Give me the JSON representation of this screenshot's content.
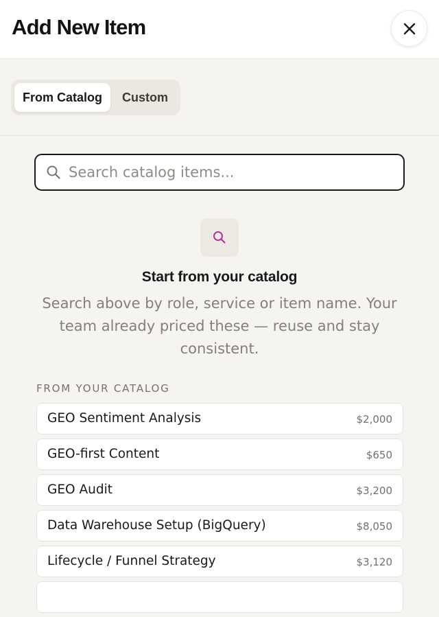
{
  "dialog": {
    "title": "Add New Item"
  },
  "tabs": [
    {
      "label": "From Catalog",
      "active": true
    },
    {
      "label": "Custom",
      "active": false
    }
  ],
  "search": {
    "placeholder": "Search catalog items...",
    "value": ""
  },
  "empty_state": {
    "icon": "search-icon",
    "title": "Start from your catalog",
    "description": "Search above by role, service or item name. Your team already priced these — reuse and stay consistent."
  },
  "catalog": {
    "section_label": "FROM YOUR CATALOG",
    "items": [
      {
        "name": "GEO Sentiment Analysis",
        "price": "$2,000"
      },
      {
        "name": "GEO-first Content",
        "price": "$650"
      },
      {
        "name": "GEO Audit",
        "price": "$3,200"
      },
      {
        "name": "Data Warehouse Setup (BigQuery)",
        "price": "$8,050"
      },
      {
        "name": "Lifecycle / Funnel Strategy",
        "price": "$3,120"
      },
      {
        "name": "",
        "price": ""
      }
    ]
  },
  "colors": {
    "accent": "#b3359a",
    "border_dark": "#1b1a18",
    "background": "#f5f4f1"
  }
}
